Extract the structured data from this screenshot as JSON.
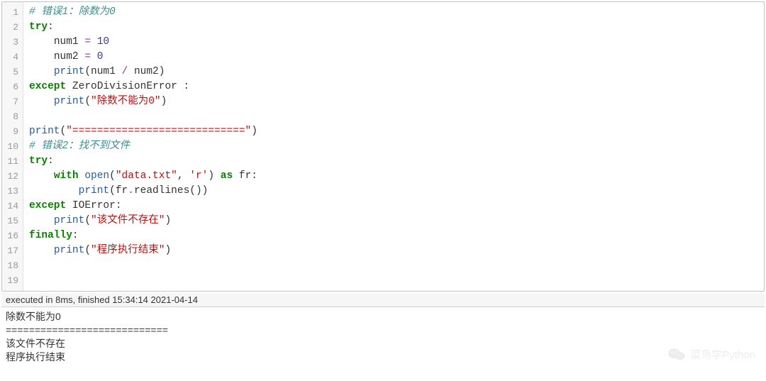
{
  "code": {
    "lines": [
      "1",
      "2",
      "3",
      "4",
      "5",
      "6",
      "7",
      "8",
      "9",
      "10",
      "11",
      "12",
      "13",
      "14",
      "15",
      "16",
      "17",
      "18",
      "19"
    ],
    "src": {
      "l1": {
        "comment": "# 错误1：除数为0"
      },
      "l2": {
        "kw": "try",
        "p": ":"
      },
      "l3": {
        "name": "num1",
        "op": " = ",
        "num": "10"
      },
      "l4": {
        "name": "num2",
        "op": " = ",
        "num": "0"
      },
      "l5": {
        "bi": "print",
        "open": "(",
        "a": "num1",
        "op": " / ",
        "b": "num2",
        "close": ")"
      },
      "l6": {
        "kw": "except",
        "err": " ZeroDivisionError ",
        "p": ":"
      },
      "l7": {
        "bi": "print",
        "open": "(",
        "str": "\"除数不能为0\"",
        "close": ")"
      },
      "l9": {
        "bi": "print",
        "open": "(",
        "str": "\"============================\"",
        "close": ")"
      },
      "l10": {
        "comment": "# 错误2：找不到文件"
      },
      "l11": {
        "kw": "try",
        "p": ":"
      },
      "l12": {
        "kw": "with",
        "bi": " open",
        "open": "(",
        "s1": "\"data.txt\"",
        "comma": ", ",
        "s2": "'r'",
        "close": ")",
        "kw2": " as ",
        "name": "fr",
        "p": ":"
      },
      "l13": {
        "bi": "print",
        "open": "(",
        "obj": "fr",
        "dot": ".",
        "method": "readlines",
        "close2": "())"
      },
      "l14": {
        "kw": "except",
        "err": " IOError",
        "p": ":"
      },
      "l15": {
        "bi": "print",
        "open": "(",
        "str": "\"该文件不存在\"",
        "close": ")"
      },
      "l16": {
        "kw": "finally",
        "p": ":"
      },
      "l17": {
        "bi": "print",
        "open": "(",
        "str": "\"程序执行结束\"",
        "close": ")"
      }
    }
  },
  "status": "executed in 8ms, finished 15:34:14 2021-04-14",
  "output": {
    "o1": "除数不能为0",
    "o2": "============================",
    "o3": "该文件不存在",
    "o4": "程序执行结束"
  },
  "watermark": "菜鸟学Python"
}
